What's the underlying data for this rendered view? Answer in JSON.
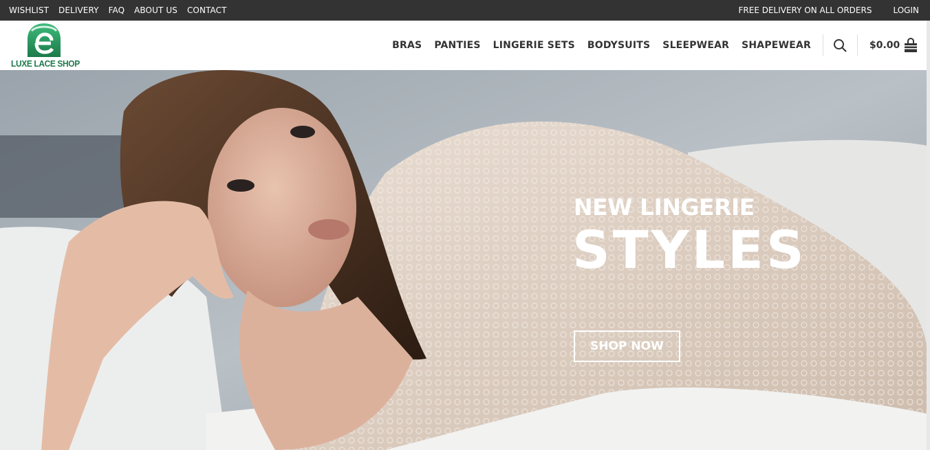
{
  "topbar": {
    "links": [
      "WISHLIST",
      "DELIVERY",
      "FAQ",
      "ABOUT US",
      "CONTACT"
    ],
    "promo": "FREE DELIVERY ON ALL ORDERS",
    "login": "LOGIN"
  },
  "header": {
    "logo_text": "LUXE LACE SHOP",
    "nav": [
      "BRAS",
      "PANTIES",
      "LINGERIE SETS",
      "BODYSUITS",
      "SLEEPWEAR",
      "SHAPEWEAR"
    ],
    "cart_amount": "$0.00",
    "icons": {
      "search": "search-icon",
      "cart": "shopping-bag-icon"
    }
  },
  "hero": {
    "subtitle": "NEW LINGERIE",
    "title": "STYLES",
    "button": "SHOP NOW"
  },
  "colors": {
    "topbar_bg": "#333333",
    "brand_green": "#1f7a4d",
    "nav_text": "#333333"
  }
}
